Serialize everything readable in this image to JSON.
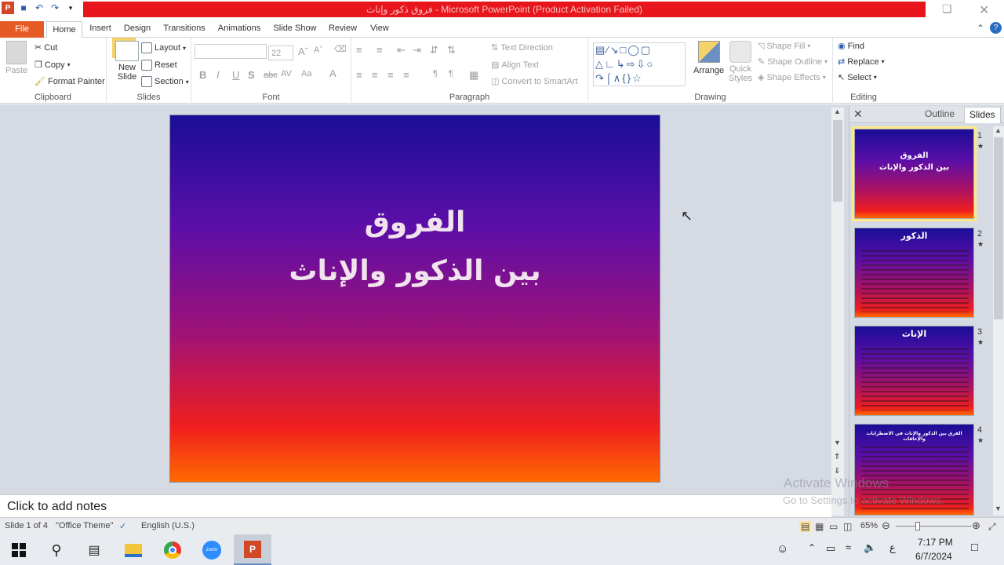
{
  "title": "فروق ذكور وإناث - Microsoft PowerPoint (Product Activation Failed)",
  "tabs": [
    "File",
    "Home",
    "Insert",
    "Design",
    "Transitions",
    "Animations",
    "Slide Show",
    "Review",
    "View"
  ],
  "clipboard": {
    "paste": "Paste",
    "cut": "Cut",
    "copy": "Copy",
    "format_painter": "Format Painter",
    "label": "Clipboard"
  },
  "slides_group": {
    "new_slide": "New Slide",
    "layout": "Layout",
    "reset": "Reset",
    "section": "Section",
    "label": "Slides"
  },
  "font": {
    "size": "22",
    "label": "Font"
  },
  "paragraph": {
    "text_direction": "Text Direction",
    "align_text": "Align Text",
    "convert_smartart": "Convert to SmartArt",
    "label": "Paragraph"
  },
  "drawing": {
    "arrange": "Arrange",
    "quick_styles": "Quick Styles",
    "shape_fill": "Shape Fill",
    "shape_outline": "Shape Outline",
    "shape_effects": "Shape Effects",
    "label": "Drawing"
  },
  "editing": {
    "find": "Find",
    "replace": "Replace",
    "select": "Select",
    "label": "Editing"
  },
  "slide": {
    "title_line1": "الفروق",
    "title_line2": "بين الذكور والإناث"
  },
  "pane": {
    "outline": "Outline",
    "slides": "Slides"
  },
  "thumbs": [
    {
      "num": "1",
      "t1": "الفروق",
      "t2": "بين الذكور والإناث"
    },
    {
      "num": "2",
      "t1": "الذكور"
    },
    {
      "num": "3",
      "t1": "الإناث"
    },
    {
      "num": "4",
      "t1": "الفرق بين الذكور والإناث في الاضطرابات والإعاقات"
    }
  ],
  "notes": "Click to add notes",
  "status": {
    "slide": "Slide 1 of 4",
    "theme": "\"Office Theme\"",
    "lang": "English (U.S.)",
    "zoom": "65%"
  },
  "watermark": {
    "line1": "Activate Windows",
    "line2": "Go to Settings to activate Windows."
  },
  "taskbar": {
    "time": "7:17 PM",
    "date": "6/7/2024",
    "input_lang": "ع"
  },
  "colors": {
    "file_tab": "#e55b25",
    "title_bar": "#e8161c",
    "selection": "#fde98a"
  }
}
